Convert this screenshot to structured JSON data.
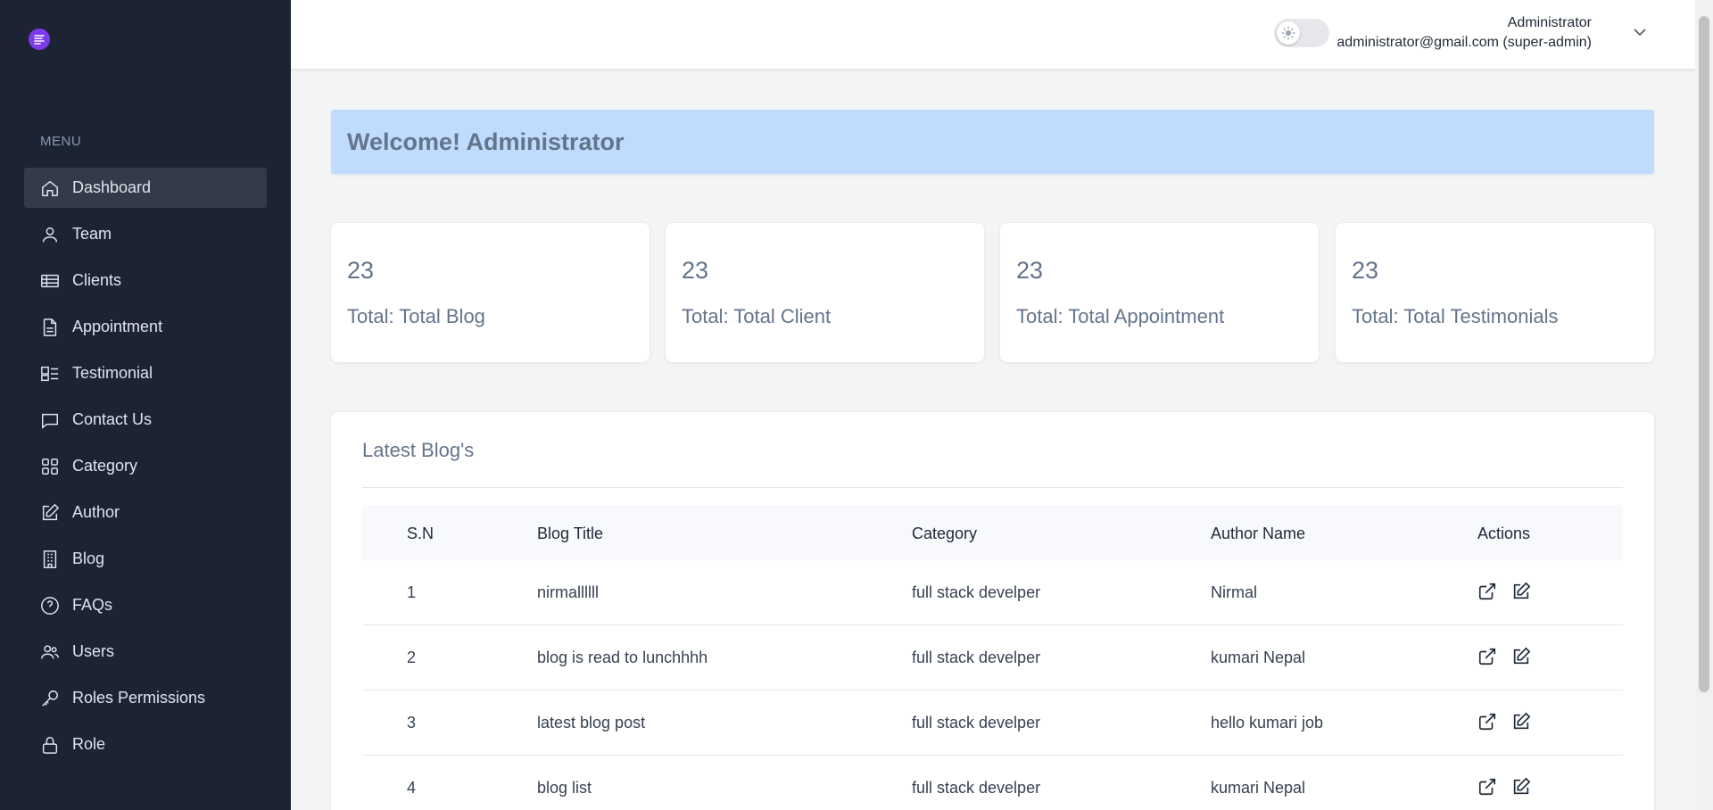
{
  "sidebar": {
    "menu_title": "MENU",
    "items": [
      {
        "label": "Dashboard",
        "icon": "home-icon",
        "active": true
      },
      {
        "label": "Team",
        "icon": "user-icon"
      },
      {
        "label": "Clients",
        "icon": "table-icon"
      },
      {
        "label": "Appointment",
        "icon": "document-icon"
      },
      {
        "label": "Testimonial",
        "icon": "layout-icon"
      },
      {
        "label": "Contact Us",
        "icon": "chat-icon"
      },
      {
        "label": "Category",
        "icon": "grid-icon"
      },
      {
        "label": "Author",
        "icon": "edit-icon"
      },
      {
        "label": "Blog",
        "icon": "building-icon"
      },
      {
        "label": "FAQs",
        "icon": "question-icon"
      },
      {
        "label": "Users",
        "icon": "users-icon"
      },
      {
        "label": "Roles Permissions",
        "icon": "key-icon"
      },
      {
        "label": "Role",
        "icon": "lock-icon"
      }
    ]
  },
  "header": {
    "user_name": "Administrator",
    "user_email": "administrator@gmail.com (super-admin)"
  },
  "welcome": "Welcome! Administrator",
  "stats": [
    {
      "value": "23",
      "label": "Total: Total Blog"
    },
    {
      "value": "23",
      "label": "Total: Total Client"
    },
    {
      "value": "23",
      "label": "Total: Total Appointment"
    },
    {
      "value": "23",
      "label": "Total: Total Testimonials"
    }
  ],
  "blogs": {
    "title": "Latest Blog's",
    "columns": [
      "S.N",
      "Blog Title",
      "Category",
      "Author Name",
      "Actions"
    ],
    "rows": [
      {
        "sn": "1",
        "title": "nirmallllll",
        "category": "full stack develper",
        "author": "Nirmal"
      },
      {
        "sn": "2",
        "title": "blog is read to lunchhhh",
        "category": "full stack develper",
        "author": "kumari Nepal"
      },
      {
        "sn": "3",
        "title": "latest blog post",
        "category": "full stack develper",
        "author": "hello kumari job"
      },
      {
        "sn": "4",
        "title": "blog list",
        "category": "full stack develper",
        "author": "kumari Nepal"
      }
    ]
  },
  "colors": {
    "sidebar_bg": "#1c2434",
    "active_item_bg": "#333a48",
    "welcome_bg": "#bfdbfe",
    "brand": "#7c3aed"
  }
}
